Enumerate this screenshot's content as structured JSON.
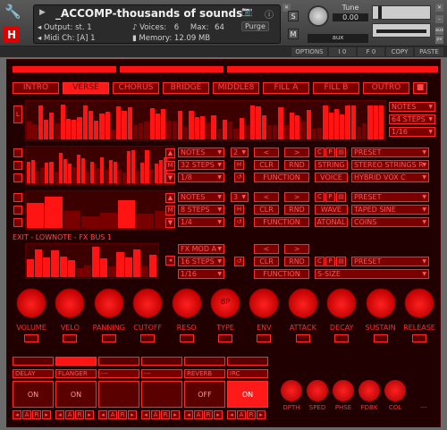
{
  "header": {
    "title": "_ACCOMP-thousands of sounds",
    "output_label": "Output:",
    "output_value": "st. 1",
    "voices_label": "Voices:",
    "voices_value": "6",
    "max_label": "Max:",
    "max_value": "64",
    "purge_label": "Purge",
    "midi_label": "Midi Ch:",
    "midi_value": "[A] 1",
    "memory_label": "Memory:",
    "memory_value": "12.09 MB",
    "tune_label": "Tune",
    "tune_value": "0.00",
    "s_label": "S",
    "m_label": "M",
    "aux_label": "aux",
    "pv_label": "pv"
  },
  "options": {
    "options_label": "OPTIONS",
    "f1": "I 0",
    "f2": "F 0",
    "copy": "COPY",
    "paste": "PASTE"
  },
  "tabs": [
    "INTRO",
    "VERSE",
    "CHORUS",
    "BRIDGE",
    "MIDDLE8",
    "FILL A",
    "FILL B",
    "OUTRO"
  ],
  "lane_top": {
    "mode": "NOTES",
    "steps": "64 STEPS",
    "rate": "1/16",
    "side": "L"
  },
  "lane1": {
    "mode": "NOTES",
    "num": "2",
    "steps": "32 STEPS",
    "rate": "1/8",
    "function": "FUNCTION",
    "clr": "CLR",
    "rnd": "RND",
    "c": "C",
    "p": "P",
    "preset": "PRESET",
    "type_btn": "STRING",
    "type_val": "STEREO STRINGS R",
    "sub_btn": "VOICE",
    "sub_val": "HYBRID VOX C"
  },
  "lane2": {
    "mode": "NOTES",
    "num": "3",
    "steps": "8 STEPS",
    "rate": "1/4",
    "function": "FUNCTION",
    "clr": "CLR",
    "rnd": "RND",
    "c": "C",
    "p": "P",
    "preset": "PRESET",
    "type_btn": "WAVE",
    "type_val": "TAPED SINE",
    "sub_btn": "ATONAL",
    "sub_val": "COINS"
  },
  "lane3": {
    "title": "EXIT - LOWNOTE - FX BUS 1",
    "mode": "FX MOD A",
    "steps": "16 STEPS",
    "rate": "1/16",
    "function": "FUNCTION",
    "clr": "CLR",
    "rnd": "RND",
    "c": "C",
    "p": "P",
    "preset": "PRESET",
    "sub_val": "S-SIZE"
  },
  "knobs": [
    {
      "label": "VOLUME"
    },
    {
      "label": "VELO"
    },
    {
      "label": "PANNING"
    },
    {
      "label": "CUTOFF"
    },
    {
      "label": "RESO"
    },
    {
      "label": "TYPE",
      "text": "BP"
    },
    {
      "label": "ENV"
    },
    {
      "label": "ATTACK"
    },
    {
      "label": "DECAY"
    },
    {
      "label": "SUSTAIN"
    },
    {
      "label": "RELEASE"
    }
  ],
  "fx": {
    "slots": [
      {
        "name": "DELAY",
        "state": "ON"
      },
      {
        "name": "FLANGER",
        "state": "ON"
      },
      {
        "name": "---",
        "state": ""
      },
      {
        "name": "---",
        "state": ""
      },
      {
        "name": "REVERB",
        "state": "OFF"
      },
      {
        "name": "IRC",
        "state": "ON"
      }
    ],
    "knobs": [
      "DPTH",
      "SPED",
      "PHSE",
      "FDBK",
      "COL"
    ],
    "dash": "---"
  },
  "colors": {
    "accent": "#ff1414",
    "bg": "#200000"
  }
}
